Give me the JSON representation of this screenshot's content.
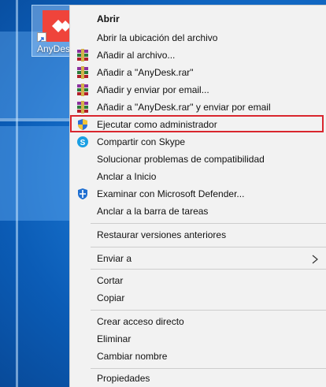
{
  "desktop": {
    "icon_label": "AnyDesk"
  },
  "menu": {
    "items": [
      {
        "label": "Abrir",
        "icon": "none"
      },
      {
        "label": "Abrir la ubicación del archivo",
        "icon": "none"
      },
      {
        "label": "Añadir al archivo...",
        "icon": "winrar-icon"
      },
      {
        "label": "Añadir a \"AnyDesk.rar\"",
        "icon": "winrar-icon"
      },
      {
        "label": "Añadir y enviar por email...",
        "icon": "winrar-icon"
      },
      {
        "label": "Añadir a \"AnyDesk.rar\" y enviar por email",
        "icon": "winrar-icon"
      },
      {
        "label": "Ejecutar como administrador",
        "icon": "uac-shield-icon"
      },
      {
        "label": "Compartir con Skype",
        "icon": "skype-icon"
      },
      {
        "label": "Solucionar problemas de compatibilidad",
        "icon": "none"
      },
      {
        "label": "Anclar a Inicio",
        "icon": "none"
      },
      {
        "label": "Examinar con Microsoft Defender...",
        "icon": "defender-icon"
      },
      {
        "label": "Anclar a la barra de tareas",
        "icon": "none"
      },
      {
        "label": "Restaurar versiones anteriores",
        "icon": "none"
      },
      {
        "label": "Enviar a",
        "icon": "chevron-right-icon"
      },
      {
        "label": "Cortar",
        "icon": "none"
      },
      {
        "label": "Copiar",
        "icon": "none"
      },
      {
        "label": "Crear acceso directo",
        "icon": "none"
      },
      {
        "label": "Eliminar",
        "icon": "none"
      },
      {
        "label": "Cambiar nombre",
        "icon": "none"
      },
      {
        "label": "Propiedades",
        "icon": "none"
      }
    ]
  },
  "colors": {
    "highlight_border": "#d9262e",
    "menu_background": "#f2f2f2",
    "anydesk_red": "#ef443b"
  }
}
